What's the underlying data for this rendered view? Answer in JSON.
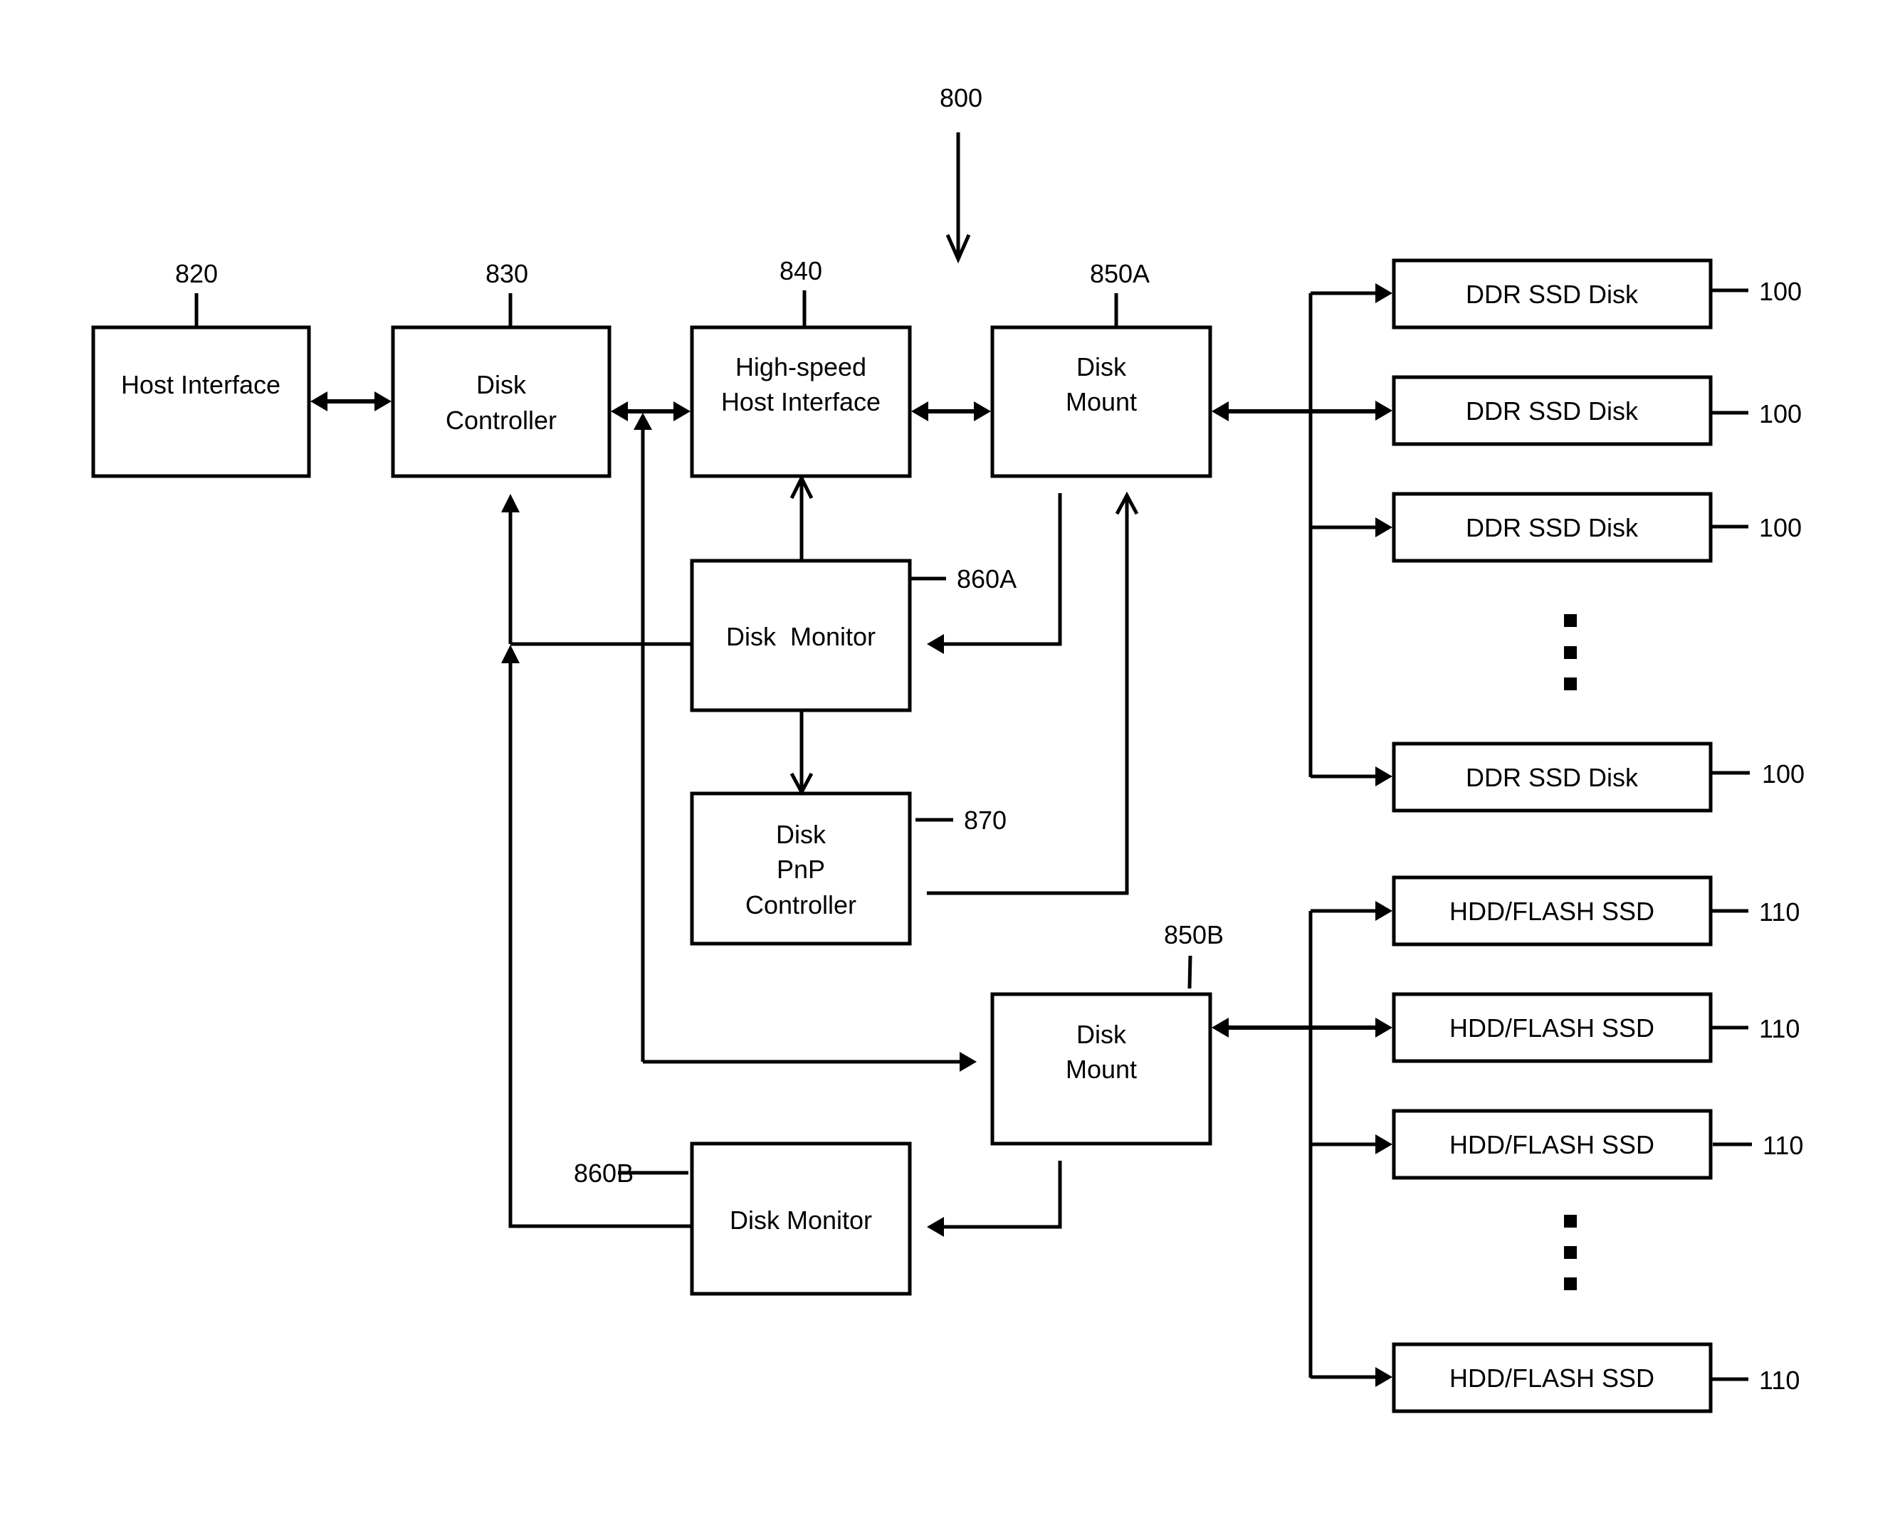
{
  "diagram": {
    "figure_ref": "800",
    "blocks": {
      "host_interface": {
        "ref": "820",
        "lines": [
          "Host Interface"
        ]
      },
      "disk_controller": {
        "ref": "830",
        "lines": [
          "Disk",
          "Controller"
        ]
      },
      "hs_host_interface": {
        "ref": "840",
        "lines": [
          "High-speed",
          "Host Interface"
        ]
      },
      "disk_mount_a": {
        "ref": "850A",
        "lines": [
          "Disk",
          "Mount"
        ]
      },
      "disk_monitor_a": {
        "ref": "860A",
        "lines": [
          "Disk  Monitor"
        ]
      },
      "pnp_controller": {
        "ref": "870",
        "lines": [
          "Disk",
          "PnP",
          "Controller"
        ]
      },
      "disk_mount_b": {
        "ref": "850B",
        "lines": [
          "Disk",
          "Mount"
        ]
      },
      "disk_monitor_b": {
        "ref": "860B",
        "lines": [
          "Disk Monitor"
        ]
      }
    },
    "ddr_disks": [
      {
        "label": "DDR SSD Disk",
        "ref": "100"
      },
      {
        "label": "DDR SSD Disk",
        "ref": "100"
      },
      {
        "label": "DDR SSD Disk",
        "ref": "100"
      },
      {
        "label": "DDR SSD Disk",
        "ref": "100"
      }
    ],
    "hdd_disks": [
      {
        "label": "HDD/FLASH SSD",
        "ref": "110"
      },
      {
        "label": "HDD/FLASH SSD",
        "ref": "110"
      },
      {
        "label": "HDD/FLASH SSD",
        "ref": "110"
      },
      {
        "label": "HDD/FLASH SSD",
        "ref": "110"
      }
    ],
    "ellipsis_marks": [
      "ddr-ellipsis",
      "hdd-ellipsis"
    ],
    "connections": [
      {
        "from": "host_interface",
        "to": "disk_controller",
        "type": "bidirectional"
      },
      {
        "from": "disk_controller",
        "to": "hs_host_interface",
        "type": "bidirectional"
      },
      {
        "from": "hs_host_interface",
        "to": "disk_mount_a",
        "type": "bidirectional"
      },
      {
        "from": "disk_mount_a",
        "to": "ddr_disks",
        "type": "bidirectional"
      },
      {
        "from": "disk_mount_b",
        "to": "hdd_disks",
        "type": "bidirectional"
      },
      {
        "from": "disk_monitor_a",
        "to": "hs_host_interface",
        "type": "directed"
      },
      {
        "from": "disk_monitor_a",
        "to": "pnp_controller",
        "type": "directed"
      },
      {
        "from": "disk_monitor_a",
        "to": "disk_controller",
        "type": "directed"
      },
      {
        "from": "disk_mount_a",
        "to": "disk_monitor_a",
        "type": "directed"
      },
      {
        "from": "pnp_controller",
        "to": "disk_mount_a",
        "type": "directed"
      },
      {
        "from": "disk_controller_bus",
        "to": "disk_mount_b",
        "type": "directed"
      },
      {
        "from": "disk_mount_b",
        "to": "disk_monitor_b",
        "type": "directed"
      },
      {
        "from": "disk_monitor_b",
        "to": "disk_controller",
        "type": "directed"
      }
    ]
  }
}
